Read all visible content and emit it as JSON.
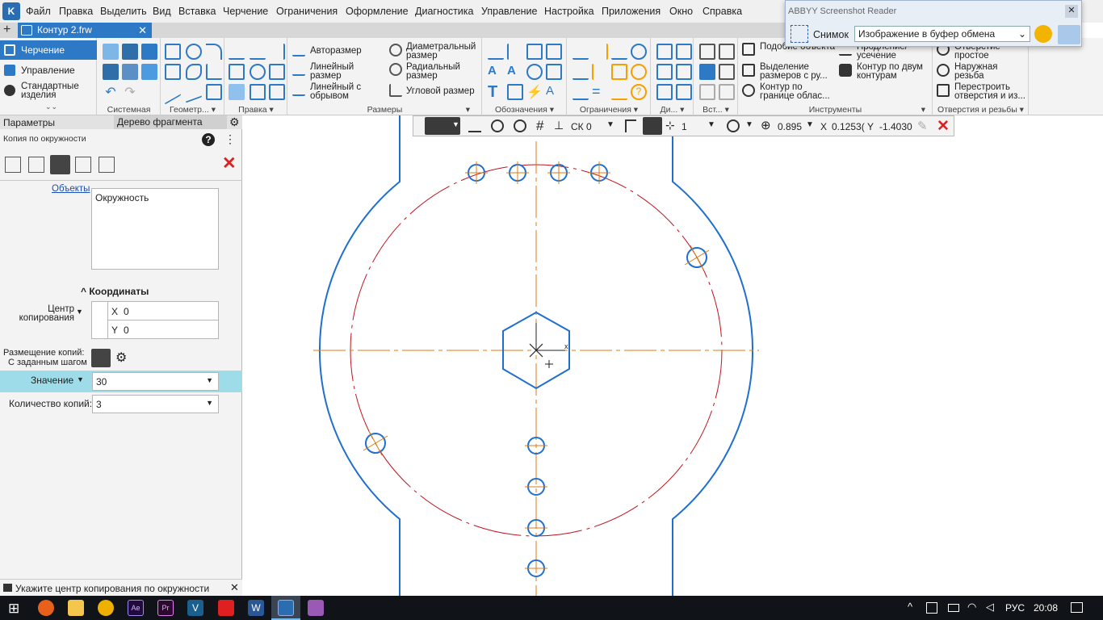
{
  "menu": [
    "Файл",
    "Правка",
    "Выделить",
    "Вид",
    "Вставка",
    "Черчение",
    "Ограничения",
    "Оформление",
    "Диагностика",
    "Управление",
    "Настройка",
    "Приложения",
    "Окно",
    "Справка"
  ],
  "document_tab": "Контур 2.frw",
  "modes": {
    "drawing": "Черчение",
    "management": "Управление",
    "standard": "Стандартные изделия"
  },
  "ribbon": {
    "groups": [
      "Системная",
      "Геометр...",
      "Правка",
      "Размеры",
      "Обозначения",
      "Ограничения",
      "Ди...",
      "Вст...",
      "Инструменты",
      "Отверстия и резьбы"
    ],
    "dimensions": {
      "auto": "Авторазмер",
      "linear": "Линейный размер",
      "linear_break": "Линейный с обрывом",
      "diametral": "Диаметральный размер",
      "radial": "Радиальный размер",
      "angular": "Угловой размер"
    },
    "tools": {
      "similar": "Подобие объекта",
      "extend": "Продление/ усечение",
      "select_dims": "Выделение размеров с ру...",
      "two_contours": "Контур по двум контурам",
      "area_contour": "Контур по границе облас..."
    },
    "holes": {
      "simple": "Отверстие простое",
      "thread": "Наружная резьба",
      "rebuild": "Перестроить отверстия и из..."
    }
  },
  "panel": {
    "tabs": [
      "Параметры",
      "Дерево фрагмента"
    ],
    "command_title": "Копия по окружности",
    "objects_link": "Объекты",
    "objects_value": "Окружность",
    "coords_header": "Координаты",
    "center_label": "Центр копирования",
    "x_label": "X",
    "x_value": "0",
    "y_label": "Y",
    "y_value": "0",
    "placement_label": "Размещение копий:",
    "placement_value": "С заданным шагом",
    "value_label": "Значение",
    "value_value": "30",
    "count_label": "Количество копий:",
    "count_value": "3",
    "status": "Укажите центр копирования по окружности"
  },
  "draw_toolbar": {
    "cs": "СК 0",
    "layer": "1",
    "zoom": "0.895",
    "x_label": "X",
    "x_value": "0.1253(",
    "y_label": "Y",
    "y_value": "-1.4030"
  },
  "abbyy": {
    "title": "ABBYY Screenshot Reader",
    "snapshot_label": "Снимок",
    "mode": "Изображение в буфер обмена"
  },
  "taskbar": {
    "lang": "РУС",
    "time": "20:08"
  },
  "colors": {
    "contour": "#1f6fcf",
    "axis": "#e07a10",
    "circle_red": "#c0141e",
    "highlight": "#9fdcea"
  }
}
